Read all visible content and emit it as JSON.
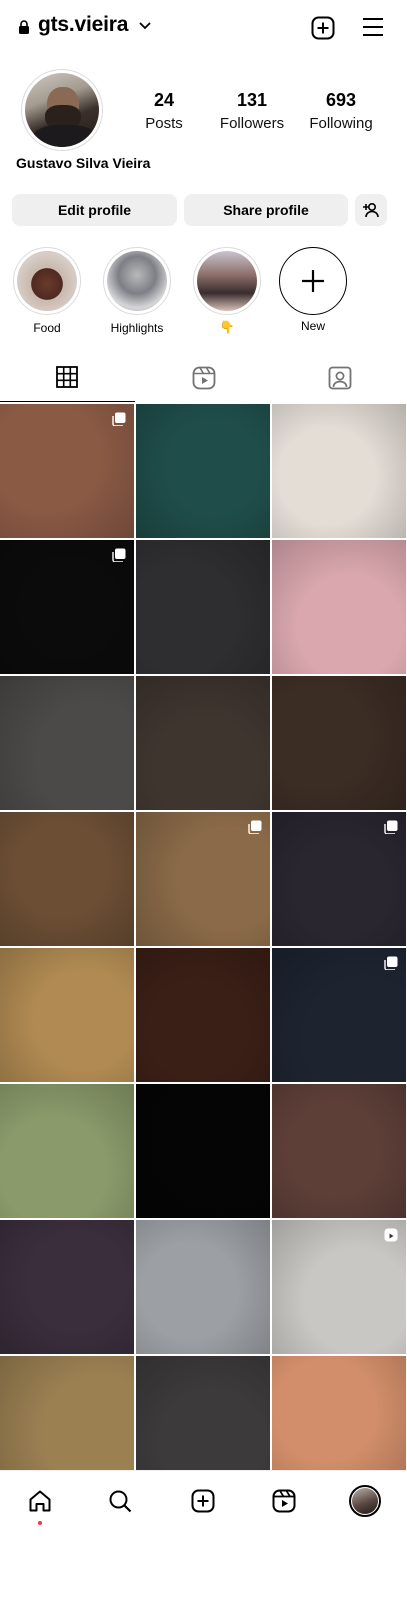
{
  "header": {
    "username": "gts.vieira",
    "new_post_icon": "plus-square-icon",
    "menu_icon": "hamburger-menu-icon"
  },
  "profile": {
    "full_name": "Gustavo Silva Vieira",
    "stats": [
      {
        "value": "24",
        "label": "Posts"
      },
      {
        "value": "131",
        "label": "Followers"
      },
      {
        "value": "693",
        "label": "Following"
      }
    ],
    "buttons": {
      "edit": "Edit profile",
      "share": "Share profile"
    }
  },
  "highlights": [
    {
      "label": "Food"
    },
    {
      "label": "Highlights"
    },
    {
      "label": "👇"
    },
    {
      "label": "New"
    }
  ],
  "tabs": [
    "grid-icon",
    "reels-icon",
    "tagged-icon"
  ],
  "grid_colors": [
    [
      "#8a5a45",
      "#1f4d4a",
      "#e4ddd6"
    ],
    [
      "#0b0b0b",
      "#2e2e30",
      "#d9a7ad"
    ],
    [
      "#4b4a48",
      "#3f352f",
      "#3b2c24"
    ],
    [
      "#6b4e34",
      "#8a6a48",
      "#2a2630"
    ],
    [
      "#b08a52",
      "#3a1f16",
      "#1d2430"
    ],
    [
      "#8a9a6a",
      "#050505",
      "#5e3f38"
    ],
    [
      "#3a2e3c",
      "#9ca0a5",
      "#c9c7c3"
    ],
    [
      "#9b8052",
      "#3d3a3c",
      "#d28e6a"
    ]
  ],
  "multi_posts": [
    "0-0",
    "1-0",
    "3-1",
    "3-2",
    "4-2"
  ],
  "reel_posts": [
    "6-2"
  ],
  "bottom_nav": [
    "home-icon",
    "search-icon",
    "create-icon",
    "reels-icon",
    "profile-avatar"
  ],
  "colors": {
    "notification_dot": "#ff3040",
    "button_bg": "#efefef"
  }
}
